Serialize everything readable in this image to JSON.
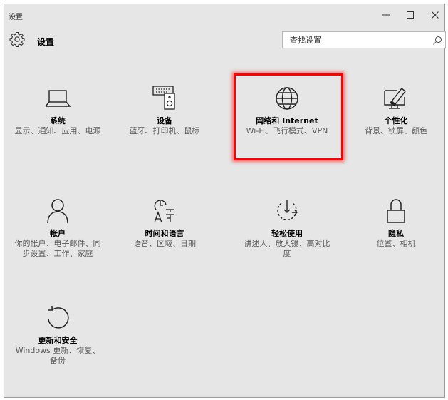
{
  "window": {
    "title": "设置",
    "controls": {
      "minimize": "–",
      "maximize": "☐",
      "close": "✕"
    }
  },
  "header": {
    "title": "设置",
    "search_placeholder": "查找设置"
  },
  "tiles": [
    {
      "icon": "laptop-icon",
      "label": "系统",
      "desc": "显示、通知、应用、电源"
    },
    {
      "icon": "devices-icon",
      "label": "设备",
      "desc": "蓝牙、打印机、鼠标"
    },
    {
      "icon": "globe-icon",
      "label": "网络和 Internet",
      "desc": "Wi-Fi、飞行模式、VPN"
    },
    {
      "icon": "personalization-icon",
      "label": "个性化",
      "desc": "背景、锁屏、颜色"
    },
    {
      "icon": "person-icon",
      "label": "帐户",
      "desc": "你的帐户、电子邮件、同步设置、工作、家庭"
    },
    {
      "icon": "time-language-icon",
      "label": "时间和语言",
      "desc": "语音、区域、日期"
    },
    {
      "icon": "ease-of-access-icon",
      "label": "轻松使用",
      "desc": "讲述人、放大镜、高对比度"
    },
    {
      "icon": "lock-icon",
      "label": "隐私",
      "desc": "位置、相机"
    },
    {
      "icon": "update-icon",
      "label": "更新和安全",
      "desc": "Windows 更新、恢复、备份"
    }
  ],
  "highlight": {
    "target": "网络和 Internet",
    "color": "#ff0000"
  },
  "colors": {
    "window_bg": "#e6e6e6",
    "desc_text": "#5a5a5a"
  }
}
